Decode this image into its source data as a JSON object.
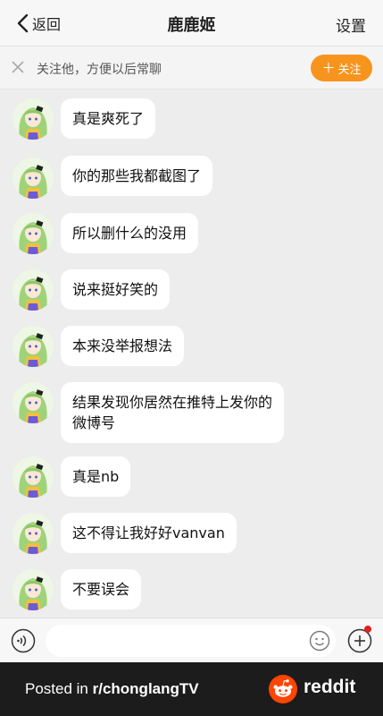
{
  "header": {
    "back_label": "返回",
    "title": "鹿鹿姬",
    "settings_label": "设置"
  },
  "banner": {
    "text": "关注他，方便以后常聊",
    "follow_label": "关注",
    "follow_color": "#f7941d"
  },
  "messages": [
    {
      "text": "真是爽死了"
    },
    {
      "text": "你的那些我都截图了"
    },
    {
      "text": "所以删什么的没用"
    },
    {
      "text": "说来挺好笑的"
    },
    {
      "text": "本来没举报想法"
    },
    {
      "text": "结果发现你居然在推特上发你的\n微博号"
    },
    {
      "text": "真是nb"
    },
    {
      "text": "这不得让我好好vanvan"
    },
    {
      "text": "不要误会"
    }
  ],
  "input": {
    "placeholder": ""
  },
  "footer": {
    "posted_prefix": "Posted in ",
    "subreddit": "r/chonglangTV",
    "brand": "reddit",
    "brand_color": "#ff4500"
  }
}
